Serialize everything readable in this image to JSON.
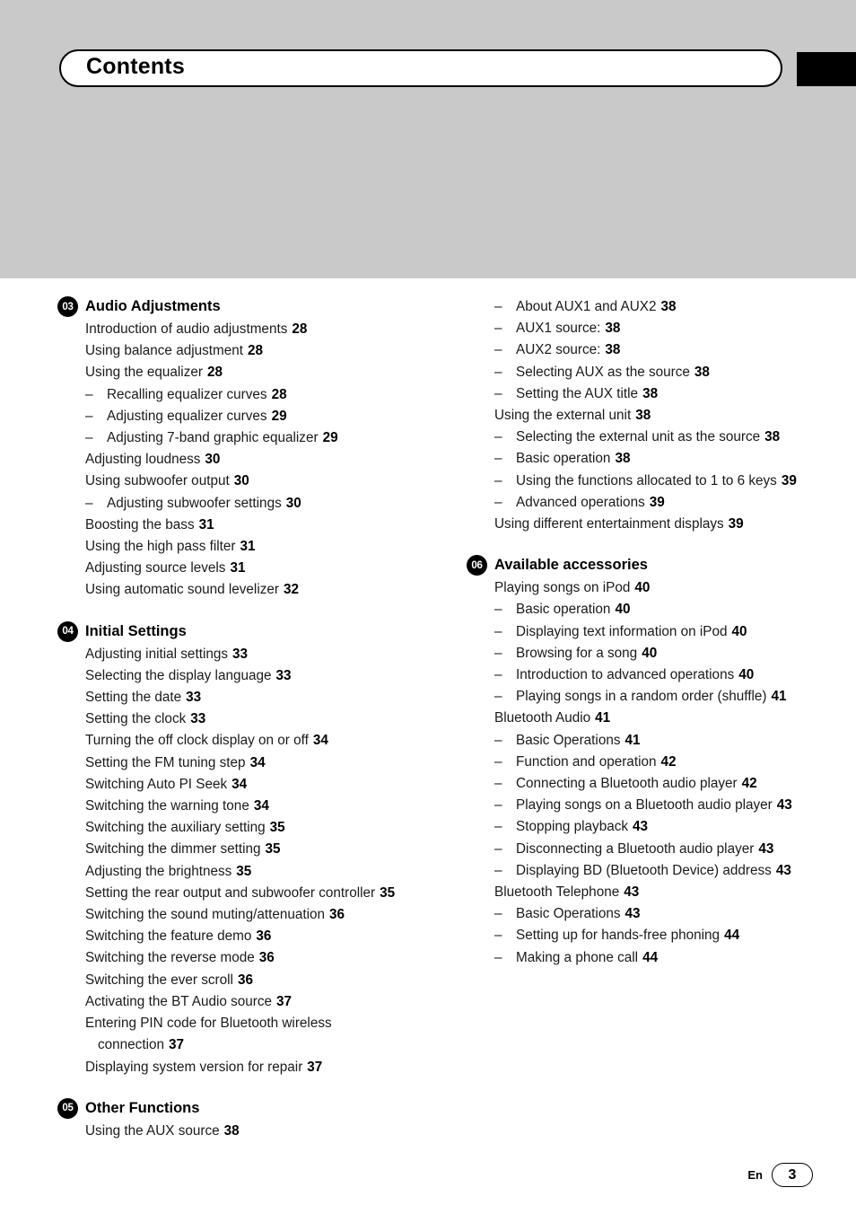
{
  "page": {
    "header_title": "Contents",
    "footer_lang": "En",
    "footer_page": "3"
  },
  "left_column": [
    {
      "number": "03",
      "title": "Audio Adjustments",
      "entries": [
        {
          "level": 1,
          "text": "Introduction of audio adjustments",
          "page": "28"
        },
        {
          "level": 1,
          "text": "Using balance adjustment",
          "page": "28"
        },
        {
          "level": 1,
          "text": "Using the equalizer",
          "page": "28"
        },
        {
          "level": 2,
          "text": "Recalling equalizer curves",
          "page": "28"
        },
        {
          "level": 2,
          "text": "Adjusting equalizer curves",
          "page": "29"
        },
        {
          "level": 2,
          "text": "Adjusting 7-band graphic equalizer",
          "page": "29"
        },
        {
          "level": 1,
          "text": "Adjusting loudness",
          "page": "30"
        },
        {
          "level": 1,
          "text": "Using subwoofer output",
          "page": "30"
        },
        {
          "level": 2,
          "text": "Adjusting subwoofer settings",
          "page": "30"
        },
        {
          "level": 1,
          "text": "Boosting the bass",
          "page": "31"
        },
        {
          "level": 1,
          "text": "Using the high pass filter",
          "page": "31"
        },
        {
          "level": 1,
          "text": "Adjusting source levels",
          "page": "31"
        },
        {
          "level": 1,
          "text": "Using automatic sound levelizer",
          "page": "32"
        }
      ]
    },
    {
      "number": "04",
      "title": "Initial Settings",
      "entries": [
        {
          "level": 1,
          "text": "Adjusting initial settings",
          "page": "33"
        },
        {
          "level": 1,
          "text": "Selecting the display language",
          "page": "33"
        },
        {
          "level": 1,
          "text": "Setting the date",
          "page": "33"
        },
        {
          "level": 1,
          "text": "Setting the clock",
          "page": "33"
        },
        {
          "level": 1,
          "text": "Turning the off clock display on or off",
          "page": "34"
        },
        {
          "level": 1,
          "text": "Setting the FM tuning step",
          "page": "34"
        },
        {
          "level": 1,
          "text": "Switching Auto PI Seek",
          "page": "34"
        },
        {
          "level": 1,
          "text": "Switching the warning tone",
          "page": "34"
        },
        {
          "level": 1,
          "text": "Switching the auxiliary setting",
          "page": "35"
        },
        {
          "level": 1,
          "text": "Switching the dimmer setting",
          "page": "35"
        },
        {
          "level": 1,
          "text": "Adjusting the brightness",
          "page": "35"
        },
        {
          "level": 1,
          "text": "Setting the rear output and subwoofer controller",
          "page": "35"
        },
        {
          "level": 1,
          "text": "Switching the sound muting/attenuation",
          "page": "36"
        },
        {
          "level": 1,
          "text": "Switching the feature demo",
          "page": "36"
        },
        {
          "level": 1,
          "text": "Switching the reverse mode",
          "page": "36"
        },
        {
          "level": 1,
          "text": "Switching the ever scroll",
          "page": "36"
        },
        {
          "level": 1,
          "text": "Activating the BT Audio source",
          "page": "37"
        },
        {
          "level": 1,
          "text": "Entering PIN code for Bluetooth wireless connection",
          "page": "37"
        },
        {
          "level": 1,
          "text": "Displaying system version for repair",
          "page": "37"
        }
      ]
    },
    {
      "number": "05",
      "title": "Other Functions",
      "entries": [
        {
          "level": 1,
          "text": "Using the AUX source",
          "page": "38"
        }
      ]
    }
  ],
  "right_column": [
    {
      "number": "",
      "title": "",
      "entries": [
        {
          "level": 2,
          "text": "About AUX1 and AUX2",
          "page": "38"
        },
        {
          "level": 2,
          "text": "AUX1 source:",
          "page": "38"
        },
        {
          "level": 2,
          "text": "AUX2 source:",
          "page": "38"
        },
        {
          "level": 2,
          "text": "Selecting AUX as the source",
          "page": "38"
        },
        {
          "level": 2,
          "text": "Setting the AUX title",
          "page": "38"
        },
        {
          "level": 1,
          "text": "Using the external unit",
          "page": "38"
        },
        {
          "level": 2,
          "text": "Selecting the external unit as the source",
          "page": "38"
        },
        {
          "level": 2,
          "text": "Basic operation",
          "page": "38"
        },
        {
          "level": 2,
          "text": "Using the functions allocated to 1 to 6 keys",
          "page": "39"
        },
        {
          "level": 2,
          "text": "Advanced operations",
          "page": "39"
        },
        {
          "level": 1,
          "text": "Using different entertainment displays",
          "page": "39"
        }
      ]
    },
    {
      "number": "06",
      "title": "Available accessories",
      "entries": [
        {
          "level": 1,
          "text": "Playing songs on iPod",
          "page": "40"
        },
        {
          "level": 2,
          "text": "Basic operation",
          "page": "40"
        },
        {
          "level": 2,
          "text": "Displaying text information on iPod",
          "page": "40"
        },
        {
          "level": 2,
          "text": "Browsing for a song",
          "page": "40"
        },
        {
          "level": 2,
          "text": "Introduction to advanced operations",
          "page": "40"
        },
        {
          "level": 2,
          "text": "Playing songs in a random order (shuffle)",
          "page": "41"
        },
        {
          "level": 1,
          "text": "Bluetooth Audio",
          "page": "41"
        },
        {
          "level": 2,
          "text": "Basic Operations",
          "page": "41"
        },
        {
          "level": 2,
          "text": "Function and operation",
          "page": "42"
        },
        {
          "level": 2,
          "text": "Connecting a Bluetooth audio player",
          "page": "42"
        },
        {
          "level": 2,
          "text": "Playing songs on a Bluetooth audio player",
          "page": "43"
        },
        {
          "level": 2,
          "text": "Stopping playback",
          "page": "43"
        },
        {
          "level": 2,
          "text": "Disconnecting a Bluetooth audio player",
          "page": "43"
        },
        {
          "level": 2,
          "text": "Displaying BD (Bluetooth Device) address",
          "page": "43"
        },
        {
          "level": 1,
          "text": "Bluetooth Telephone",
          "page": "43"
        },
        {
          "level": 2,
          "text": "Basic Operations",
          "page": "43"
        },
        {
          "level": 2,
          "text": "Setting up for hands-free phoning",
          "page": "44"
        },
        {
          "level": 2,
          "text": "Making a phone call",
          "page": "44"
        }
      ]
    }
  ]
}
